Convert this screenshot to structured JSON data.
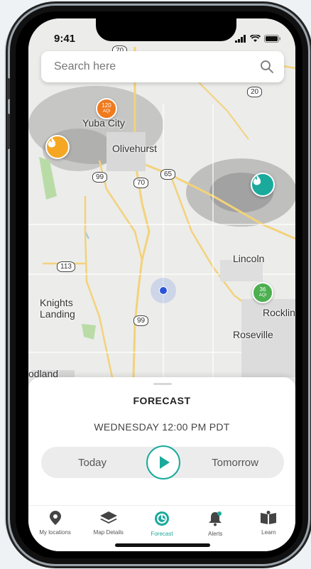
{
  "status": {
    "time": "9:41"
  },
  "search": {
    "placeholder": "Search here"
  },
  "map": {
    "cities": {
      "yuba_city": "Yuba City",
      "olivehurst": "Olivehurst",
      "lincoln": "Lincoln",
      "knights_landing_1": "Knights",
      "knights_landing_2": "Landing",
      "roseville": "Roseville",
      "rocklin": "Rocklin",
      "woodland": "odland"
    },
    "routes": {
      "r70_top": "70",
      "r20": "20",
      "r99_a": "99",
      "r70_mid": "70",
      "r65": "65",
      "r113": "113",
      "r99_b": "99"
    },
    "aqi_markers": [
      {
        "value": "120",
        "unit": "AQI",
        "color": "#f07a1e"
      },
      {
        "value": "36",
        "unit": "AQI",
        "color": "#4caf50"
      }
    ],
    "fire_markers": [
      {
        "color": "#f5a623"
      },
      {
        "color": "#1aaa9c"
      }
    ]
  },
  "forecast": {
    "title": "FORECAST",
    "datetime": "WEDNESDAY 12:00 PM PDT",
    "today_label": "Today",
    "tomorrow_label": "Tomorrow"
  },
  "tabs": [
    {
      "label": "My locations",
      "icon": "location-pin-icon"
    },
    {
      "label": "Map Details",
      "icon": "layers-icon"
    },
    {
      "label": "Forecast",
      "icon": "forecast-clock-icon",
      "active": true
    },
    {
      "label": "Alerts",
      "icon": "bell-icon"
    },
    {
      "label": "Learn",
      "icon": "book-icon"
    }
  ],
  "colors": {
    "accent": "#1aaa9c",
    "aqi_orange": "#f07a1e",
    "aqi_green": "#4caf50",
    "fire_yellow": "#f5a623"
  }
}
